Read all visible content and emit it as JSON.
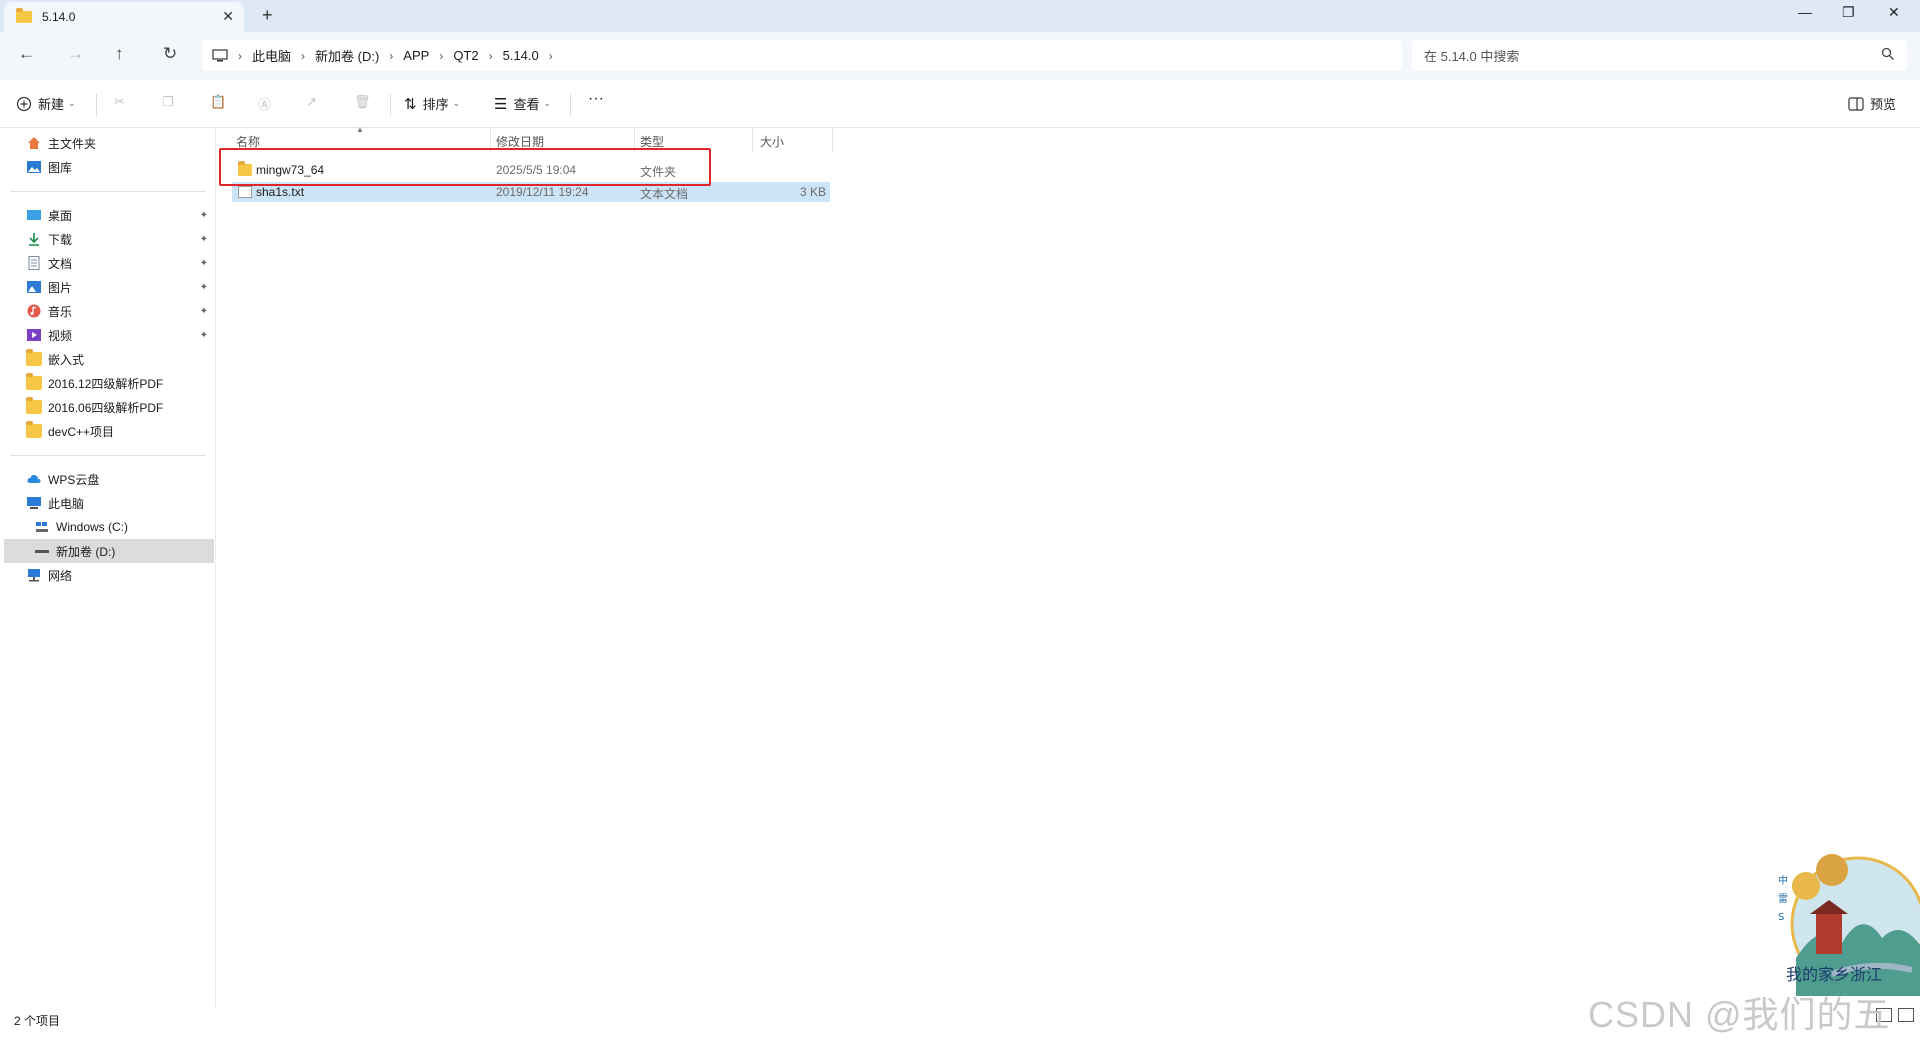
{
  "window": {
    "tab_title": "5.14.0",
    "close_tab": "✕",
    "new_tab": "+",
    "minimize": "—",
    "restore": "❐",
    "close": "✕"
  },
  "nav": {
    "back": "←",
    "forward": "→",
    "up": "↑",
    "refresh": "↻"
  },
  "address": {
    "crumbs": [
      "此电脑",
      "新加卷 (D:)",
      "APP",
      "QT2",
      "5.14.0"
    ],
    "separator": "›"
  },
  "search": {
    "placeholder": "在 5.14.0 中搜索",
    "icon": "search-icon"
  },
  "toolbar": {
    "new_label": "新建",
    "sort_label": "排序",
    "view_label": "查看",
    "more_label": "···",
    "preview_label": "预览"
  },
  "sidebar": {
    "top": [
      {
        "label": "主文件夹",
        "icon": "home-icon"
      },
      {
        "label": "图库",
        "icon": "gallery-icon"
      }
    ],
    "pinned": [
      {
        "label": "桌面",
        "icon": "desktop-icon"
      },
      {
        "label": "下载",
        "icon": "download-icon"
      },
      {
        "label": "文档",
        "icon": "document-icon"
      },
      {
        "label": "图片",
        "icon": "pictures-icon"
      },
      {
        "label": "音乐",
        "icon": "music-icon"
      },
      {
        "label": "视频",
        "icon": "video-icon"
      }
    ],
    "folders": [
      {
        "label": "嵌入式"
      },
      {
        "label": "2016.12四级解析PDF"
      },
      {
        "label": "2016.06四级解析PDF"
      },
      {
        "label": "devC++项目"
      }
    ],
    "locations": [
      {
        "label": "WPS云盘",
        "icon": "cloud-icon"
      },
      {
        "label": "此电脑",
        "icon": "computer-icon"
      },
      {
        "label": "Windows (C:)",
        "icon": "windows-drive-icon"
      },
      {
        "label": "新加卷 (D:)",
        "icon": "drive-icon"
      },
      {
        "label": "网络",
        "icon": "network-icon"
      }
    ],
    "pin_glyph": "📌"
  },
  "columns": {
    "name": "名称",
    "date": "修改日期",
    "type": "类型",
    "size": "大小"
  },
  "files": [
    {
      "name": "mingw73_64",
      "date": "2025/5/5 19:04",
      "type": "文件夹",
      "size": ""
    },
    {
      "name": "sha1s.txt",
      "date": "2019/12/11 19:24",
      "type": "文本文档",
      "size": "3 KB"
    }
  ],
  "status": {
    "item_count": "2 个项目"
  },
  "watermark": {
    "csdn": "CSDN @我们的五年",
    "stamp_text": "我的家乡浙江"
  },
  "colors": {
    "accent_highlight": "#e0252b",
    "selection": "#cce4f7",
    "folder": "#f7c644"
  }
}
